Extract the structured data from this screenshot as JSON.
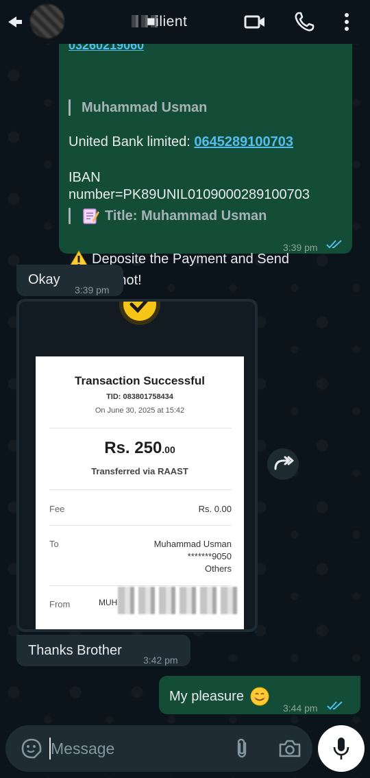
{
  "header": {
    "contact_name": "■ilient",
    "icons": [
      "back-icon",
      "video-call-icon",
      "voice-call-icon",
      "more-options-icon"
    ]
  },
  "messages": {
    "m1": {
      "clipped_number": "03260219060",
      "quote1": "Muhammad Usman",
      "bank_label": "United Bank limited: ",
      "bank_account": "0645289100703",
      "iban_line1": "IBAN",
      "iban_line2": "number=PK89UNIL0109000289100703",
      "quote2": "Title: Muhammad Usman",
      "deposit_line1": "Deposite the Payment and Send",
      "deposit_line2": "Screenshot!",
      "time": "3:39 pm"
    },
    "m2": {
      "text": "Okay",
      "time": "3:39 pm"
    },
    "m3": {
      "receipt": {
        "title": "Transaction Successful",
        "tid": "TID: 083801758434",
        "date": "On June 30, 2025 at 15:42",
        "amount_main": "Rs. 250",
        "amount_dec": ".00",
        "via": "Transferred via RAAST",
        "fee_label": "Fee",
        "fee_value": "Rs. 0.00",
        "to_label": "To",
        "to_name": "Muhammad Usman",
        "to_account": "*******9050",
        "to_bank": "Others",
        "from_label": "From",
        "from_name": "MUH"
      }
    },
    "m4": {
      "text": "Thanks Brother",
      "time": "3:42 pm"
    },
    "m5": {
      "text": "My pleasure",
      "time": "3:44 pm"
    }
  },
  "composer": {
    "placeholder": "Message"
  },
  "colors": {
    "background": "#0b141a",
    "outgoing_bubble": "#144d37",
    "incoming_bubble": "#1f2c33",
    "link": "#53bdeb",
    "read_ticks": "#53bdeb"
  }
}
